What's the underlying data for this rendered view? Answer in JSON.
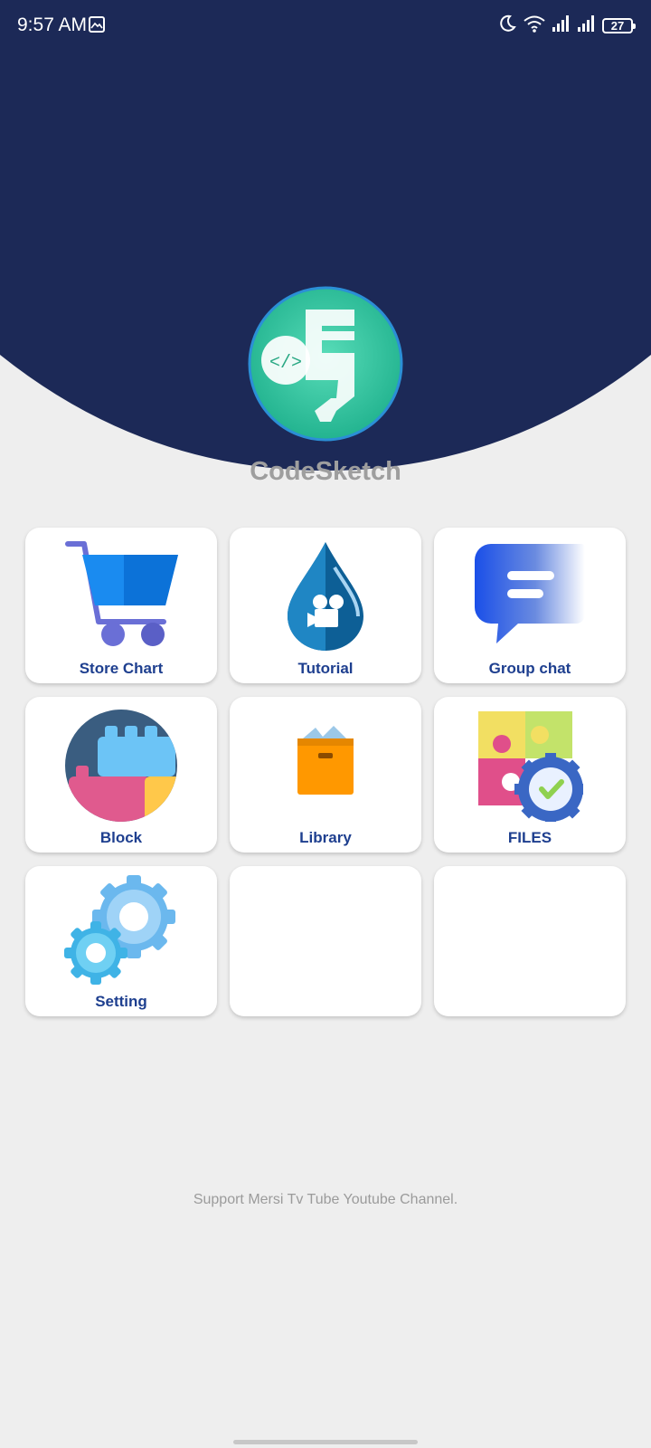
{
  "status_bar": {
    "time": "9:57 AM",
    "battery": "27",
    "icons": [
      "gallery-icon",
      "moon-icon",
      "wifi-icon",
      "signal-icon",
      "signal-icon",
      "battery-icon"
    ]
  },
  "header": {
    "app_name": "CodeSketch",
    "logo_text": "</>",
    "background_color": "#1c2957",
    "logo_color": "#35c9a0"
  },
  "menu": {
    "items": [
      {
        "label": "Store Chart",
        "icon": "shopping-cart-icon"
      },
      {
        "label": "Tutorial",
        "icon": "video-drop-icon"
      },
      {
        "label": "Group chat",
        "icon": "chat-bubble-icon"
      },
      {
        "label": "Block",
        "icon": "blocks-icon"
      },
      {
        "label": "Library",
        "icon": "box-icon"
      },
      {
        "label": "FILES",
        "icon": "puzzle-gear-icon"
      },
      {
        "label": "Setting",
        "icon": "gears-icon"
      },
      {
        "label": "",
        "icon": ""
      },
      {
        "label": "",
        "icon": ""
      }
    ]
  },
  "footer": {
    "note": "Support Mersi Tv Tube Youtube Channel."
  }
}
